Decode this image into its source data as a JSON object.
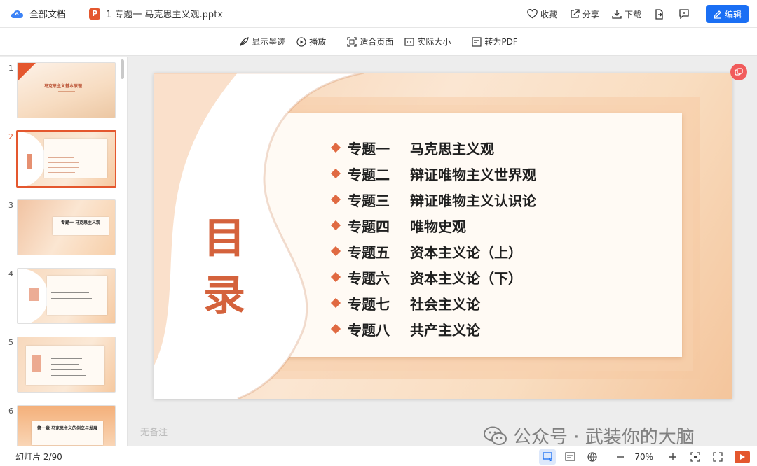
{
  "topbar": {
    "all_docs": "全部文档",
    "doc_title": "1 专题一 马克思主义观.pptx",
    "file_badge": "P",
    "favorite": "收藏",
    "share": "分享",
    "download": "下载",
    "edit": "编辑"
  },
  "toolbar": {
    "show_ink": "显示墨迹",
    "play": "播放",
    "fit_page": "适合页面",
    "actual_size": "实际大小",
    "to_pdf": "转为PDF"
  },
  "thumbnails": [
    {
      "num": "1",
      "title": "马克思主义基本原理"
    },
    {
      "num": "2",
      "title": ""
    },
    {
      "num": "3",
      "title": "专题一 马克思主义观"
    },
    {
      "num": "4",
      "title": ""
    },
    {
      "num": "5",
      "title": ""
    },
    {
      "num": "6",
      "title": "第一章 马克思主义的创立与发展"
    }
  ],
  "slide": {
    "heading": "目录",
    "toc": [
      {
        "topic": "专题一",
        "name": "马克思主义观"
      },
      {
        "topic": "专题二",
        "name": "辩证唯物主义世界观"
      },
      {
        "topic": "专题三",
        "name": "辩证唯物主义认识论"
      },
      {
        "topic": "专题四",
        "name": "唯物史观"
      },
      {
        "topic": "专题五",
        "name": "资本主义论（上）"
      },
      {
        "topic": "专题六",
        "name": "资本主义论（下）"
      },
      {
        "topic": "专题七",
        "name": "社会主义论"
      },
      {
        "topic": "专题八",
        "name": "共产主义论"
      }
    ]
  },
  "notes_placeholder": "无备注",
  "watermark": "公众号 · 武装你的大脑",
  "statusbar": {
    "slide_count": "幻灯片 2/90",
    "zoom": "70%"
  },
  "colors": {
    "accent": "#1a6ff4",
    "ppt_orange": "#e4572e",
    "slide_red": "#d4623c"
  }
}
